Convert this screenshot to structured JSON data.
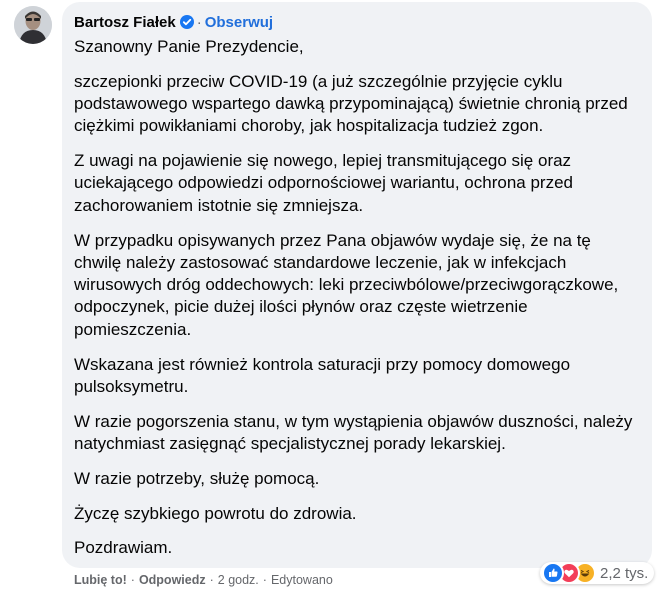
{
  "comment": {
    "author": "Bartosz Fiałek",
    "follow_label": "Obserwuj",
    "paragraphs": [
      "Szanowny Panie Prezydencie,",
      "szczepionki przeciw COVID-19 (a już szczególnie przyjęcie cyklu podstawowego wspartego dawką przypominającą) świetnie chronią przed ciężkimi powikłaniami choroby, jak hospitalizacja tudzież zgon.",
      "Z uwagi na pojawienie się nowego, lepiej transmitującego się oraz uciekającego odpowiedzi odpornościowej wariantu, ochrona przed zachorowaniem istotnie się zmniejsza.",
      "W przypadku opisywanych przez Pana objawów wydaje się, że na tę chwilę należy zastosować standardowe leczenie, jak w infekcjach wirusowych dróg oddechowych: leki przeciwbólowe/przeciwgorączkowe, odpoczynek, picie dużej ilości płynów oraz częste wietrzenie pomieszczenia.",
      "Wskazana jest również kontrola saturacji przy pomocy domowego pulsoksymetru.",
      "W razie pogorszenia stanu, w tym wystąpienia objawów duszności, należy natychmiast zasięgnąć specjalistycznej porady lekarskiej.",
      "W razie potrzeby, służę pomocą.",
      "Życzę szybkiego powrotu do zdrowia.",
      "Pozdrawiam."
    ],
    "reactions": {
      "count": "2,2 tys.",
      "types": [
        "like-icon",
        "love-icon",
        "haha-icon"
      ]
    },
    "actions": {
      "like_label": "Lubię to!",
      "reply_label": "Odpowiedz",
      "time": "2 godz.",
      "edited": "Edytowano",
      "separator": "·"
    }
  },
  "colors": {
    "bubble": "#f0f2f5",
    "accent": "#216fdb",
    "secondary_text": "#65676b"
  }
}
